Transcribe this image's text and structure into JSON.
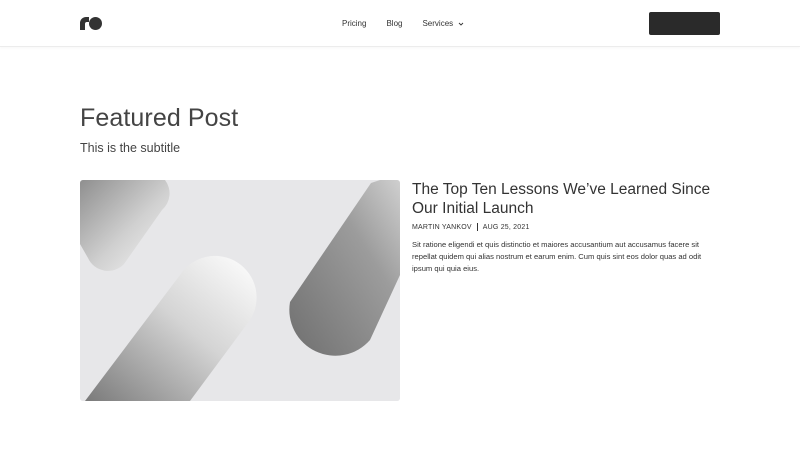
{
  "nav": {
    "logo_name": "logo",
    "links": [
      "Pricing",
      "Blog",
      "Services"
    ],
    "cta_label": ""
  },
  "header": {
    "title": "Featured Post",
    "subtitle": "This is the subtitle"
  },
  "post": {
    "title": "The Top Ten Lessons We’ve Learned Since Our Initial Launch",
    "author": "MARTIN YANKOV",
    "date": "AUG 25, 2021",
    "excerpt": "Sit ratione eligendi et quis distinctio et maiores accusantium aut accusamus facere sit repellat quidem qui alias nostrum et earum enim. Cum quis sint eos dolor quas ad odit ipsum qui quia eius."
  },
  "colors": {
    "cta": "#2a2a2a",
    "image_bg": "#e7e7e9",
    "text": "#333333"
  }
}
